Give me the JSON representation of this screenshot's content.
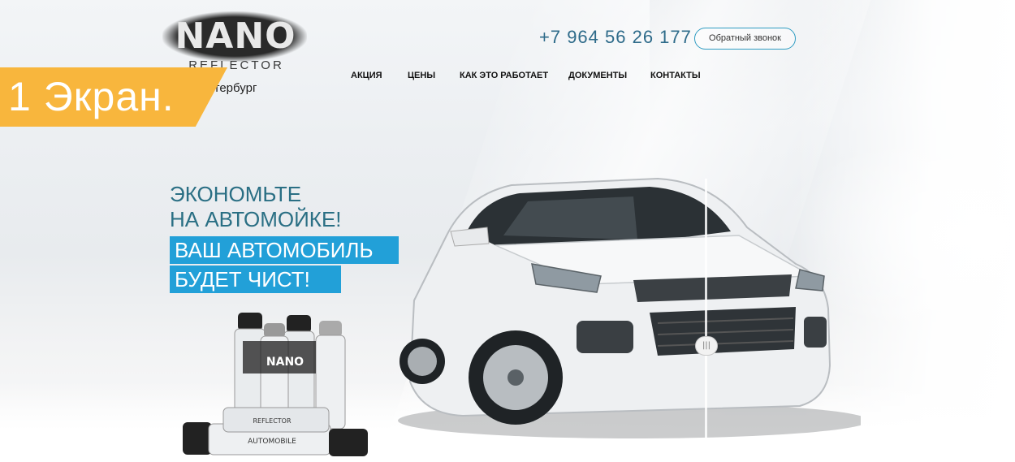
{
  "logo": {
    "brand": "NANO",
    "sub": "REFLECTOR",
    "city": "-Петербург"
  },
  "ribbon": {
    "label": "1 Экран."
  },
  "header": {
    "phone": "+7 964 56 26 177",
    "callback_label": "Обратный звонок"
  },
  "nav": {
    "items": [
      {
        "label": "АКЦИЯ"
      },
      {
        "label": "ЦЕНЫ"
      },
      {
        "label": "КАК ЭТО РАБОТАЕТ"
      },
      {
        "label": "ДОКУМЕНТЫ"
      },
      {
        "label": "КОНТАКТЫ"
      }
    ]
  },
  "hero": {
    "line1": "ЭКОНОМЬТЕ",
    "line2": "НА АВТОМОЙКЕ!",
    "highlight1": "ВАШ АВТОМОБИЛЬ",
    "highlight2": "БУДЕТ ЧИСТ!"
  },
  "product": {
    "can_brand": "NANO",
    "can_sub": "REFLECTOR",
    "can_type": "AUTOMOBILE"
  },
  "compare": {
    "handle_glyph": "|||"
  },
  "colors": {
    "accent_blue": "#22a0d8",
    "heading_teal": "#2a6f84",
    "ribbon_orange": "#f8b63d"
  }
}
